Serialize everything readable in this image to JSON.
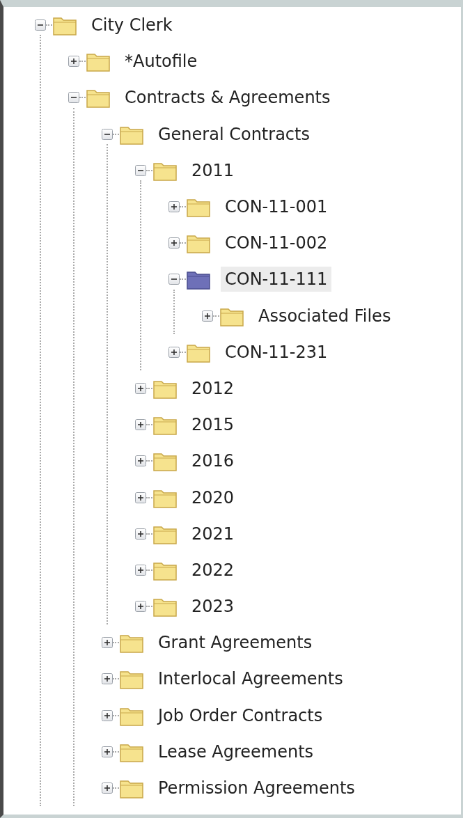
{
  "tree": [
    {
      "label": "City Clerk",
      "expanded": true,
      "selected": false,
      "children": [
        {
          "label": "*Autofile",
          "expanded": false,
          "selected": false
        },
        {
          "label": "Contracts & Agreements",
          "expanded": true,
          "selected": false,
          "children": [
            {
              "label": "General Contracts",
              "expanded": true,
              "selected": false,
              "children": [
                {
                  "label": "2011",
                  "expanded": true,
                  "selected": false,
                  "children": [
                    {
                      "label": "CON-11-001",
                      "expanded": false,
                      "selected": false
                    },
                    {
                      "label": "CON-11-002",
                      "expanded": false,
                      "selected": false
                    },
                    {
                      "label": "CON-11-111",
                      "expanded": true,
                      "selected": true,
                      "children": [
                        {
                          "label": "Associated Files",
                          "expanded": false,
                          "selected": false
                        }
                      ]
                    },
                    {
                      "label": "CON-11-231",
                      "expanded": false,
                      "selected": false
                    }
                  ]
                },
                {
                  "label": "2012",
                  "expanded": false,
                  "selected": false
                },
                {
                  "label": "2015",
                  "expanded": false,
                  "selected": false
                },
                {
                  "label": "2016",
                  "expanded": false,
                  "selected": false
                },
                {
                  "label": "2020",
                  "expanded": false,
                  "selected": false
                },
                {
                  "label": "2021",
                  "expanded": false,
                  "selected": false
                },
                {
                  "label": "2022",
                  "expanded": false,
                  "selected": false
                },
                {
                  "label": "2023",
                  "expanded": false,
                  "selected": false
                }
              ]
            },
            {
              "label": "Grant Agreements",
              "expanded": false,
              "selected": false
            },
            {
              "label": "Interlocal Agreements",
              "expanded": false,
              "selected": false
            },
            {
              "label": "Job Order Contracts",
              "expanded": false,
              "selected": false
            },
            {
              "label": "Lease Agreements",
              "expanded": false,
              "selected": false
            },
            {
              "label": "Permission Agreements",
              "expanded": false,
              "selected": false
            }
          ]
        }
      ]
    }
  ]
}
